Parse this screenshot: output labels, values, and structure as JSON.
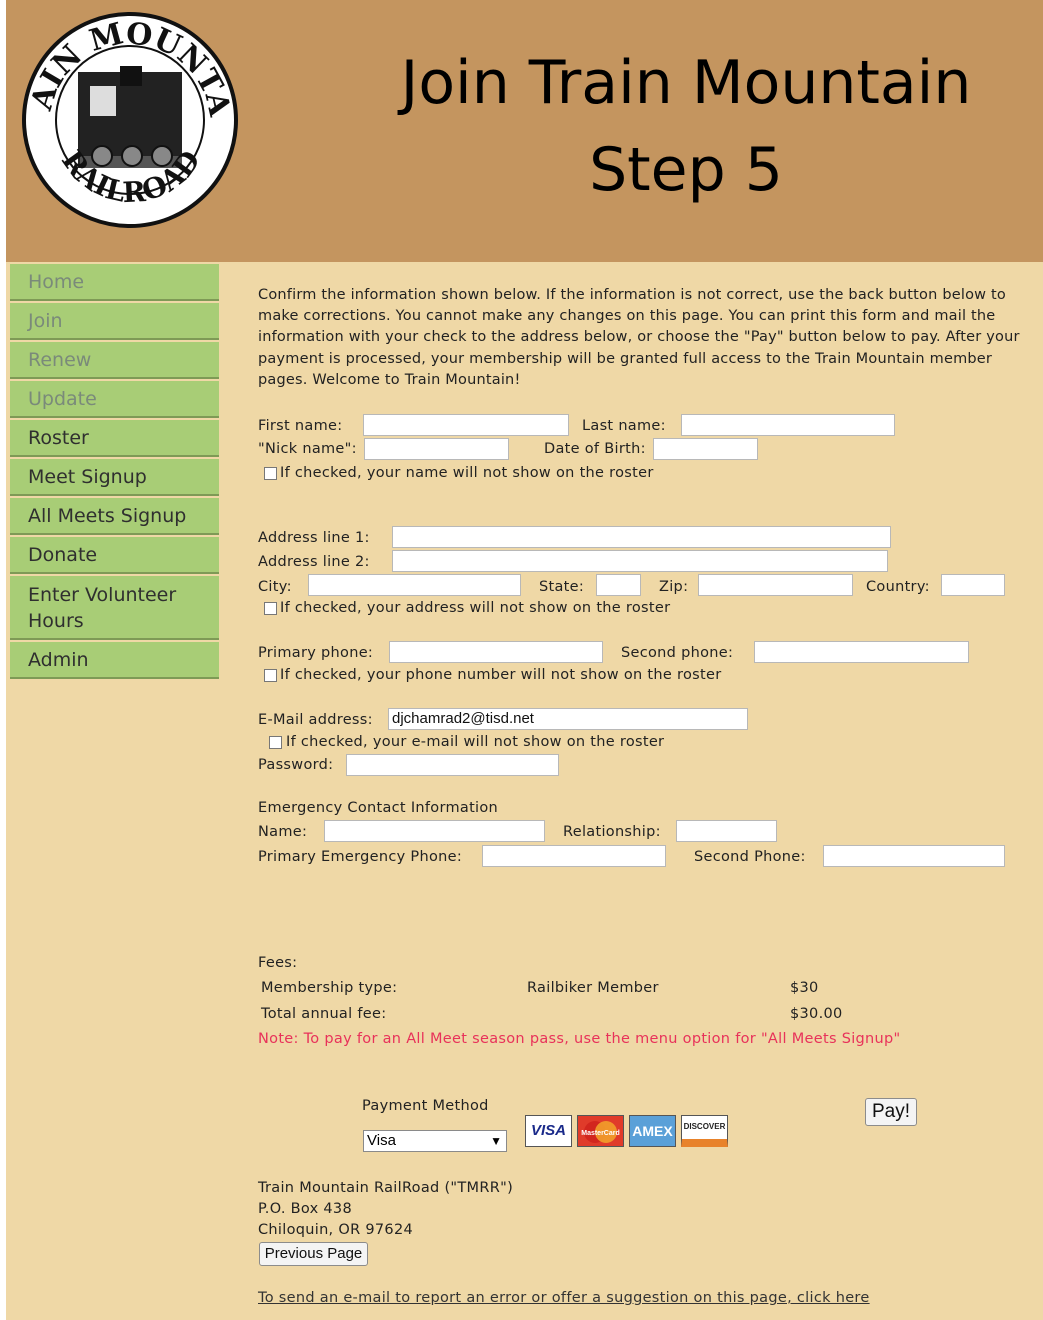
{
  "header": {
    "logo_text_top": "TRAIN MOUNTAIN",
    "logo_text_bottom": "RAILROAD",
    "title_line1": "Join Train Mountain",
    "title_line2": "Step 5"
  },
  "nav": {
    "items": [
      {
        "label": "Home"
      },
      {
        "label": "Join"
      },
      {
        "label": "Renew"
      },
      {
        "label": "Update"
      },
      {
        "label": "Roster"
      },
      {
        "label": "Meet Signup"
      },
      {
        "label": "All Meets Signup"
      },
      {
        "label": "Donate"
      },
      {
        "label": "Enter Volunteer Hours"
      },
      {
        "label": "Admin"
      }
    ]
  },
  "intro": "Confirm the information shown below.  If the information is not correct, use the back button below to make corrections.  You cannot make any changes on this page.  You can print this form and mail the information with your check to the address below, or choose the \"Pay\" button below to pay.  After your payment is processed, your membership will be granted full access to the Train Mountain member pages.  Welcome to Train Mountain!",
  "form": {
    "first_name_label": "First name:",
    "first_name": "",
    "last_name_label": "Last name:",
    "last_name": "",
    "nick_name_label": "\"Nick name\":",
    "nick_name": "",
    "dob_label": "Date of Birth:",
    "dob": "",
    "hide_name_label": "If checked, your name will not show on the roster",
    "address1_label": "Address line 1:",
    "address1": "",
    "address2_label": "Address line 2:",
    "address2": "",
    "city_label": "City:",
    "city": "",
    "state_label": "State:",
    "state": "",
    "zip_label": "Zip:",
    "zip": "",
    "country_label": "Country:",
    "country": "",
    "hide_address_label": "If checked, your address will not show on the roster",
    "primary_phone_label": "Primary phone:",
    "primary_phone": "",
    "second_phone_label": "Second phone:",
    "second_phone": "",
    "hide_phone_label": "If checked, your phone number will not show on the roster",
    "email_label": "E-Mail address:",
    "email": "djchamrad2@tisd.net",
    "hide_email_label": "If checked, your e-mail will not show on the roster",
    "password_label": "Password:",
    "password": ""
  },
  "emergency": {
    "heading": "Emergency Contact Information",
    "name_label": "Name:",
    "name": "",
    "relationship_label": "Relationship:",
    "relationship": "",
    "primary_phone_label": "Primary Emergency Phone:",
    "primary_phone": "",
    "second_phone_label": "Second Phone:",
    "second_phone": ""
  },
  "fees": {
    "heading": "Fees:",
    "membership_type_label": "Membership type:",
    "membership_type": "Railbiker Member",
    "membership_amount": "$30",
    "total_label": "Total annual fee:",
    "total_amount": "$30.00",
    "note": "Note: To pay for an All Meet season pass, use the menu option for \"All Meets Signup\""
  },
  "payment": {
    "label": "Payment Method",
    "selected": "Visa",
    "cards": [
      "VISA",
      "MasterCard",
      "AMEX",
      "DISCOVER"
    ],
    "pay_button": "Pay!"
  },
  "address": {
    "line1": "Train Mountain RailRoad (\"TMRR\")",
    "line2": "P.O. Box 438",
    "line3": "Chiloquin, OR 97624"
  },
  "previous_button": "Previous Page",
  "footer_link": "To send an e-mail to report an error or offer a suggestion on this page, click here",
  "colors": {
    "header_bg": "#c4955f",
    "page_bg": "#efd8a6",
    "nav_bg": "#a8cd76",
    "note": "#e8325a"
  }
}
